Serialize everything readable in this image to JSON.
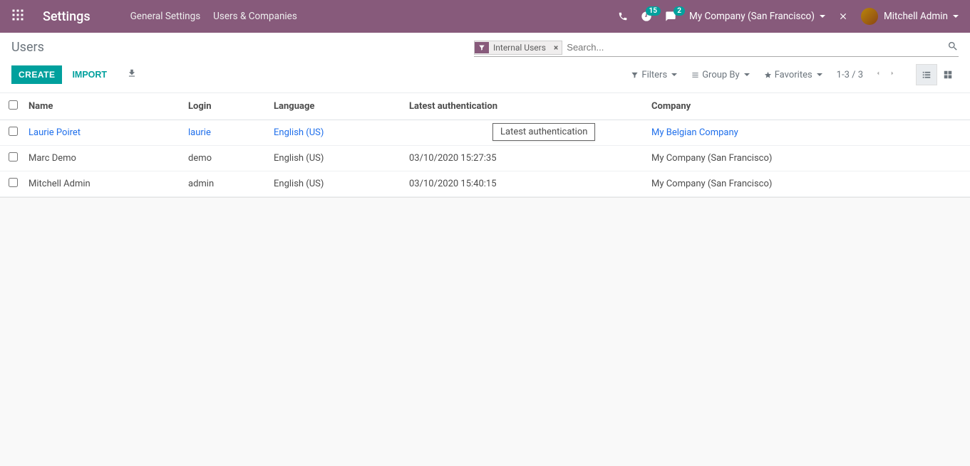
{
  "navbar": {
    "brand": "Settings",
    "menu": [
      "General Settings",
      "Users & Companies"
    ],
    "clock_badge": "15",
    "chat_badge": "2",
    "company": "My Company (San Francisco)",
    "user": "Mitchell Admin"
  },
  "control": {
    "breadcrumb": "Users",
    "filter_facet": "Internal Users",
    "search_placeholder": "Search...",
    "create": "CREATE",
    "import": "IMPORT",
    "filters": "Filters",
    "groupby": "Group By",
    "favorites": "Favorites",
    "pager": "1-3 / 3"
  },
  "table": {
    "headers": {
      "name": "Name",
      "login": "Login",
      "lang": "Language",
      "auth": "Latest authentication",
      "company": "Company"
    },
    "tooltip": "Latest authentication",
    "rows": [
      {
        "name": "Laurie Poiret",
        "login": "laurie",
        "lang": "English (US)",
        "auth": "",
        "company": "My Belgian Company",
        "link": true
      },
      {
        "name": "Marc Demo",
        "login": "demo",
        "lang": "English (US)",
        "auth": "03/10/2020 15:27:35",
        "company": "My Company (San Francisco)",
        "link": false
      },
      {
        "name": "Mitchell Admin",
        "login": "admin",
        "lang": "English (US)",
        "auth": "03/10/2020 15:40:15",
        "company": "My Company (San Francisco)",
        "link": false
      }
    ]
  }
}
